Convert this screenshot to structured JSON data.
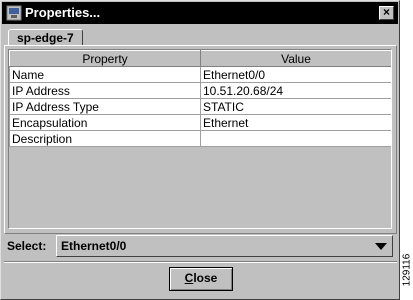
{
  "window": {
    "title": "Properties...",
    "close_glyph": "×"
  },
  "tab": {
    "label": "sp-edge-7"
  },
  "table": {
    "headers": [
      "Property",
      "Value"
    ],
    "rows": [
      [
        "Name",
        "Ethernet0/0"
      ],
      [
        "IP Address",
        "10.51.20.68/24"
      ],
      [
        "IP Address Type",
        "STATIC"
      ],
      [
        "Encapsulation",
        "Ethernet"
      ],
      [
        "Description",
        ""
      ]
    ]
  },
  "select": {
    "label": "Select:",
    "value": "Ethernet0/0"
  },
  "buttons": {
    "close_mnemonic": "C",
    "close_rest": "lose"
  },
  "figure_number": "129116",
  "icons": {
    "app": "app-icon",
    "close": "close-icon",
    "dropdown": "chevron-down-icon"
  },
  "colors": {
    "title_bar": "#000000",
    "window_bg": "#c0c0c0",
    "cell_bg": "#ffffff"
  }
}
